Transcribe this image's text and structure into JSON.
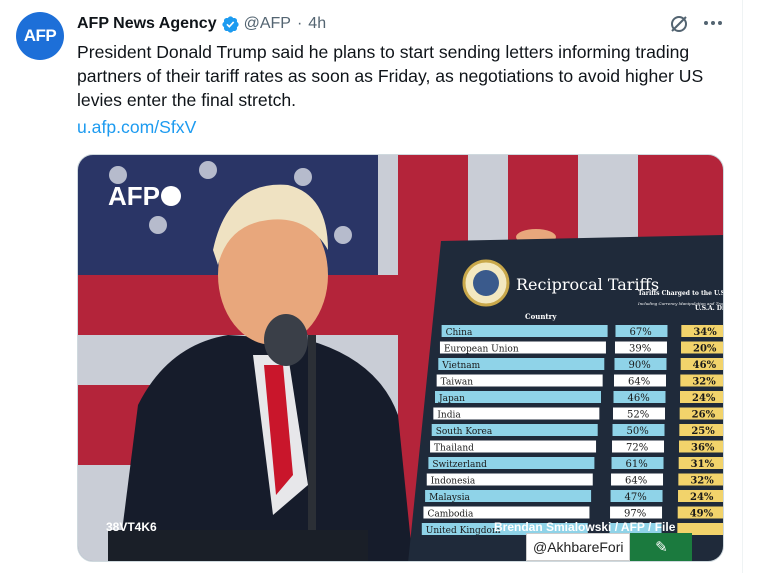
{
  "tweet": {
    "avatar_text": "AFP",
    "display_name": "AFP News Agency",
    "handle": "@AFP",
    "separator": "·",
    "time": "4h",
    "text": "President Donald Trump said he plans to start sending letters informing trading partners of their tariff rates as soon as Friday, as negotiations to avoid higher US levies enter the final stretch.",
    "link": "u.afp.com/SfxV"
  },
  "icons": {
    "verified": "verified-badge-icon",
    "grok": "grok-icon",
    "more": "more-options-icon"
  },
  "colors": {
    "accent": "#1d9bf0",
    "avatar_bg": "#1d6fd8",
    "muted": "#536471",
    "board": "#1f2a3a",
    "country_bar": "#8fd3e8",
    "reciprocal_bar": "#f2d36b"
  },
  "media": {
    "logo_text": "AFP",
    "image_code": "38VT4K6",
    "credit": "Brendan Smialowski / AFP / File",
    "watermark_handle": "@AkhbareFori",
    "board": {
      "title": "Reciprocal Tariffs",
      "col_country": "Country",
      "col_charged": "Tariffs Charged to the U.S.A.",
      "col_charged_note": "Including Currency Manipulation and Trade Barriers",
      "col_reciprocal": "U.S.A. Discounted Reciprocal",
      "rows": [
        {
          "country": "China",
          "charged": "67%",
          "reciprocal": "34%"
        },
        {
          "country": "European Union",
          "charged": "39%",
          "reciprocal": "20%"
        },
        {
          "country": "Vietnam",
          "charged": "90%",
          "reciprocal": "46%"
        },
        {
          "country": "Taiwan",
          "charged": "64%",
          "reciprocal": "32%"
        },
        {
          "country": "Japan",
          "charged": "46%",
          "reciprocal": "24%"
        },
        {
          "country": "India",
          "charged": "52%",
          "reciprocal": "26%"
        },
        {
          "country": "South Korea",
          "charged": "50%",
          "reciprocal": "25%"
        },
        {
          "country": "Thailand",
          "charged": "72%",
          "reciprocal": "36%"
        },
        {
          "country": "Switzerland",
          "charged": "61%",
          "reciprocal": "31%"
        },
        {
          "country": "Indonesia",
          "charged": "64%",
          "reciprocal": "32%"
        },
        {
          "country": "Malaysia",
          "charged": "47%",
          "reciprocal": "24%"
        },
        {
          "country": "Cambodia",
          "charged": "97%",
          "reciprocal": "49%"
        },
        {
          "country": "United Kingdom",
          "charged": "",
          "reciprocal": ""
        }
      ]
    }
  }
}
